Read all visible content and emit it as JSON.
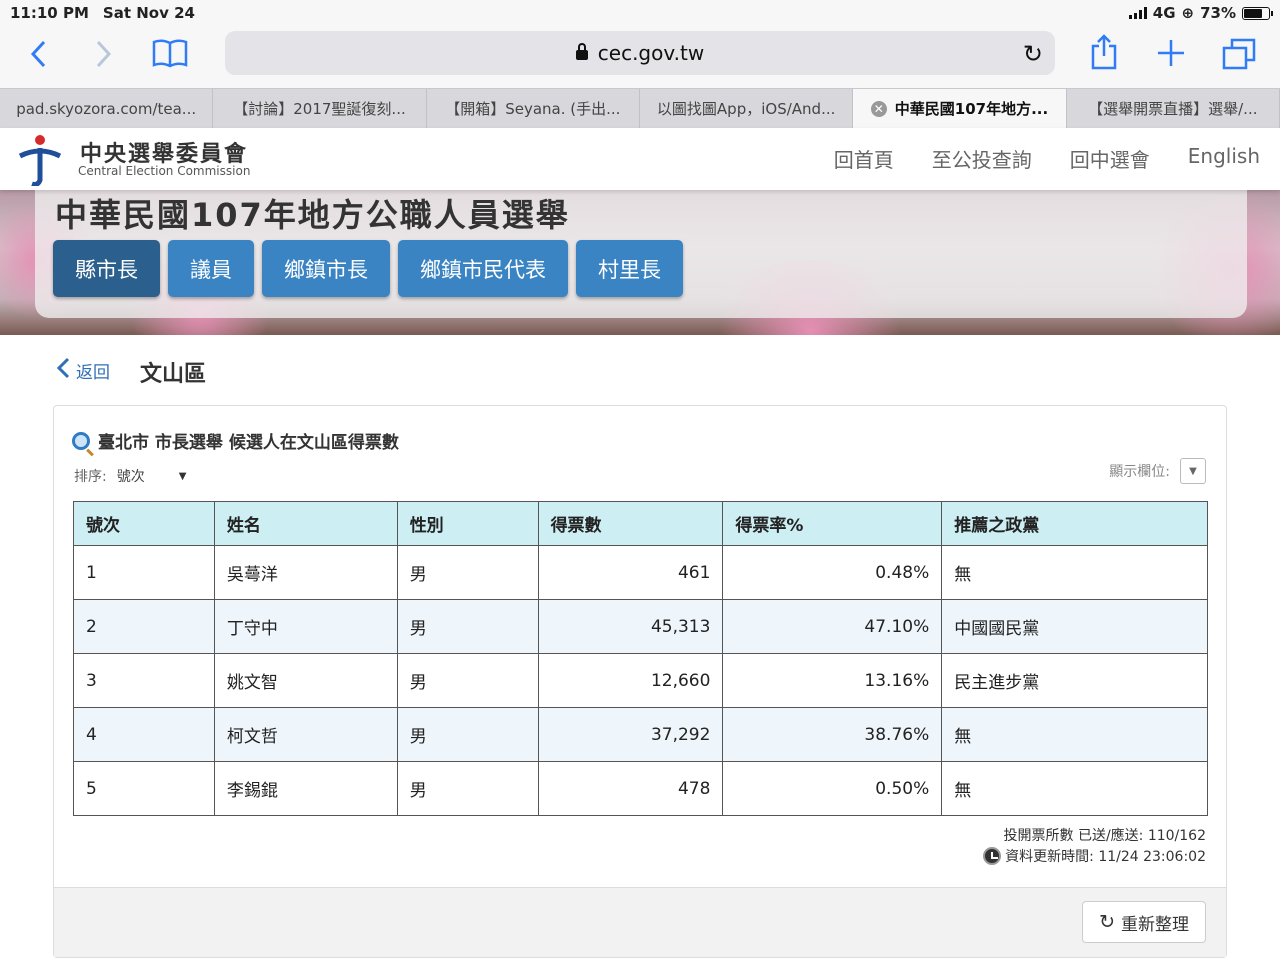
{
  "status_bar": {
    "time": "11:10 PM",
    "date": "Sat Nov 24",
    "network": "4G",
    "battery": "73%",
    "battery_level": 0.73
  },
  "browser": {
    "url": "cec.gov.tw",
    "tabs": [
      {
        "label": "pad.skyozora.com/tea..."
      },
      {
        "label": "【討論】2017聖誕復刻..."
      },
      {
        "label": "【開箱】Seyana. (手出..."
      },
      {
        "label": "以圖找圖App，iOS/And..."
      },
      {
        "label": "中華民國107年地方...",
        "active": true
      },
      {
        "label": "【選舉開票直播】選舉/..."
      }
    ]
  },
  "site": {
    "logo_zh": "中央選舉委員會",
    "logo_en": "Central Election Commission",
    "nav": [
      "回首頁",
      "至公投查詢",
      "回中選會",
      "English"
    ],
    "banner_title": "中華民國107年地方公職人員選舉",
    "categories": [
      "縣市長",
      "議員",
      "鄉鎮市長",
      "鄉鎮市民代表",
      "村里長"
    ],
    "active_category": "縣市長"
  },
  "page": {
    "back_label": "返回",
    "title": "文山區",
    "card_title": "臺北市 市長選舉 候選人在文山區得票數",
    "sort_label": "排序:",
    "sort_value": "號次",
    "columns_label": "顯示欄位:",
    "table": {
      "headers": [
        "號次",
        "姓名",
        "性別",
        "得票數",
        "得票率%",
        "推薦之政黨"
      ],
      "rows": [
        [
          "1",
          "吳蕚洋",
          "男",
          "461",
          "0.48%",
          "無"
        ],
        [
          "2",
          "丁守中",
          "男",
          "45,313",
          "47.10%",
          "中國國民黨"
        ],
        [
          "3",
          "姚文智",
          "男",
          "12,660",
          "13.16%",
          "民主進步黨"
        ],
        [
          "4",
          "柯文哲",
          "男",
          "37,292",
          "38.76%",
          "無"
        ],
        [
          "5",
          "李錫錕",
          "男",
          "478",
          "0.50%",
          "無"
        ]
      ]
    },
    "stations": "投開票所數 已送/應送: 110/162",
    "updated": "資料更新時間: 11/24 23:06:02",
    "refresh_label": "重新整理"
  }
}
